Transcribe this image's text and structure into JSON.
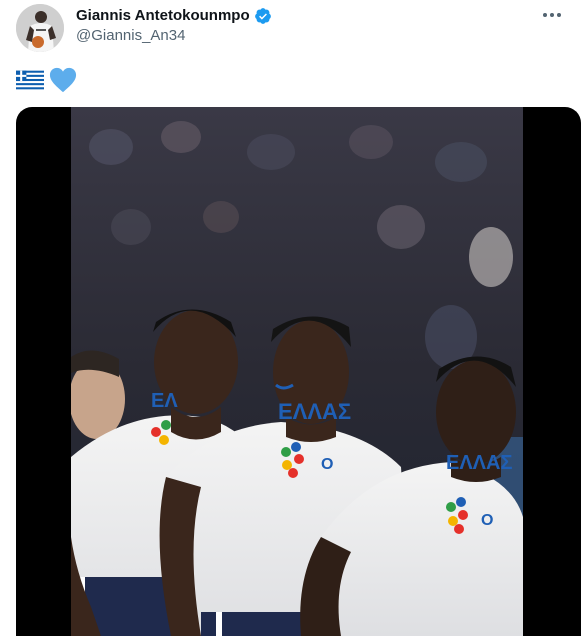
{
  "author": {
    "display_name": "Giannis Antetokounmpo",
    "handle": "@Giannis_An34",
    "verified": true,
    "avatar_icon": "avatar-photo"
  },
  "tweet": {
    "emojis": [
      "greece-flag-emoji",
      "blue-heart-emoji"
    ]
  },
  "media": {
    "type": "video",
    "jersey_text": "ΕΛΛΑΣ",
    "colors": {
      "jersey": "#f2f2f2",
      "greek_blue": "#1f5fb5",
      "background": "#000000"
    }
  },
  "colors": {
    "verified": "#1d9bf0",
    "handle": "#536471",
    "name": "#0f1419",
    "heart": "#5dadec"
  }
}
